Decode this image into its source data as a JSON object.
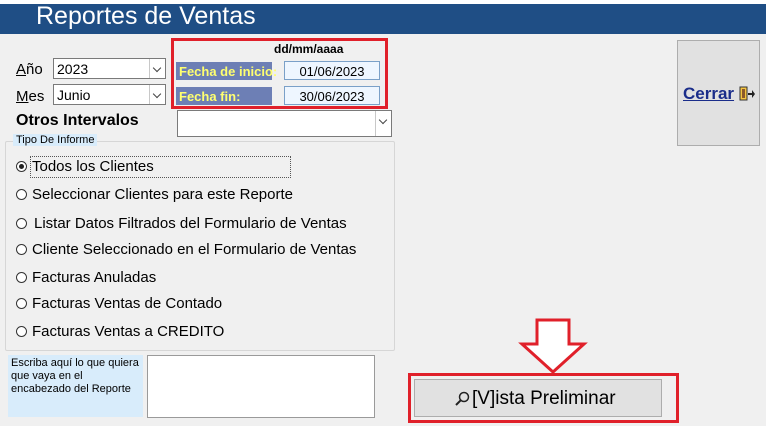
{
  "window": {
    "title": "Reportes de Ventas"
  },
  "filters": {
    "year_label": "Año",
    "year_value": "2023",
    "month_label": "Mes",
    "month_value": "Junio",
    "intervals_label": "Otros Intervalos",
    "intervals_value": ""
  },
  "dates": {
    "format_hint": "dd/mm/aaaa",
    "start_label": "Fecha de inicio:",
    "start_value": "01/06/2023",
    "end_label": "Fecha fin:",
    "end_value": "30/06/2023"
  },
  "report_type": {
    "caption": "Tipo De Informe",
    "options": [
      {
        "label": "Todos los Clientes",
        "selected": true
      },
      {
        "label": "Seleccionar Clientes para este Reporte",
        "selected": false
      },
      {
        "label": "Listar Datos Filtrados del Formulario de Ventas",
        "selected": false
      },
      {
        "label": "Cliente Seleccionado en el Formulario de Ventas",
        "selected": false
      },
      {
        "label": "Facturas Anuladas",
        "selected": false
      },
      {
        "label": "Facturas Ventas de Contado",
        "selected": false
      },
      {
        "label": "Facturas Ventas a CREDITO",
        "selected": false
      }
    ]
  },
  "header_note": {
    "label": "Escriba aquí lo que quiera que vaya en el encabezado del Reporte",
    "value": ""
  },
  "buttons": {
    "close_label": "Cerrar",
    "preview_label": "[V]ista Preliminar"
  },
  "colors": {
    "titlebar": "#1f4e85",
    "highlight_border": "#e0202a",
    "date_label_bg": "#6d7fb5",
    "date_label_fg": "#ffff70"
  }
}
